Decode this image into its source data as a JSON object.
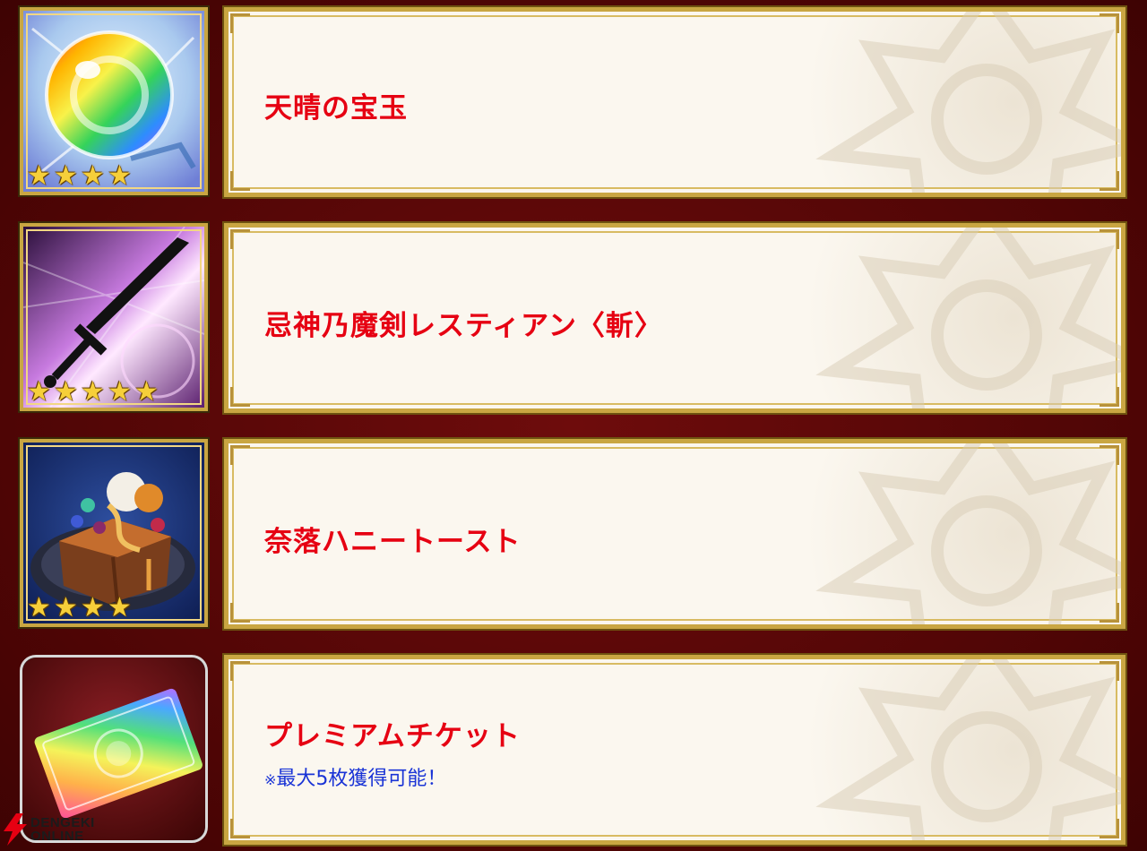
{
  "items": [
    {
      "name": "天晴の宝玉",
      "stars": 4,
      "icon": "rainbow-orb-icon"
    },
    {
      "name": "忌神乃魔剣レスティアン〈斬〉",
      "stars": 5,
      "icon": "black-sword-icon"
    },
    {
      "name": "奈落ハニートースト",
      "stars": 4,
      "icon": "honey-toast-icon"
    },
    {
      "name": "プレミアムチケット",
      "note_mark": "※",
      "note": "最大5枚獲得可能！",
      "icon": "rainbow-ticket-icon"
    }
  ],
  "watermark": {
    "line1": "DENGEKI",
    "line2": "ONLINE"
  },
  "colors": {
    "name": "#e60012",
    "note": "#1a34d6",
    "gold_border": "#c9a642",
    "background": "#5a0808",
    "panel": "#fbf7ef"
  }
}
